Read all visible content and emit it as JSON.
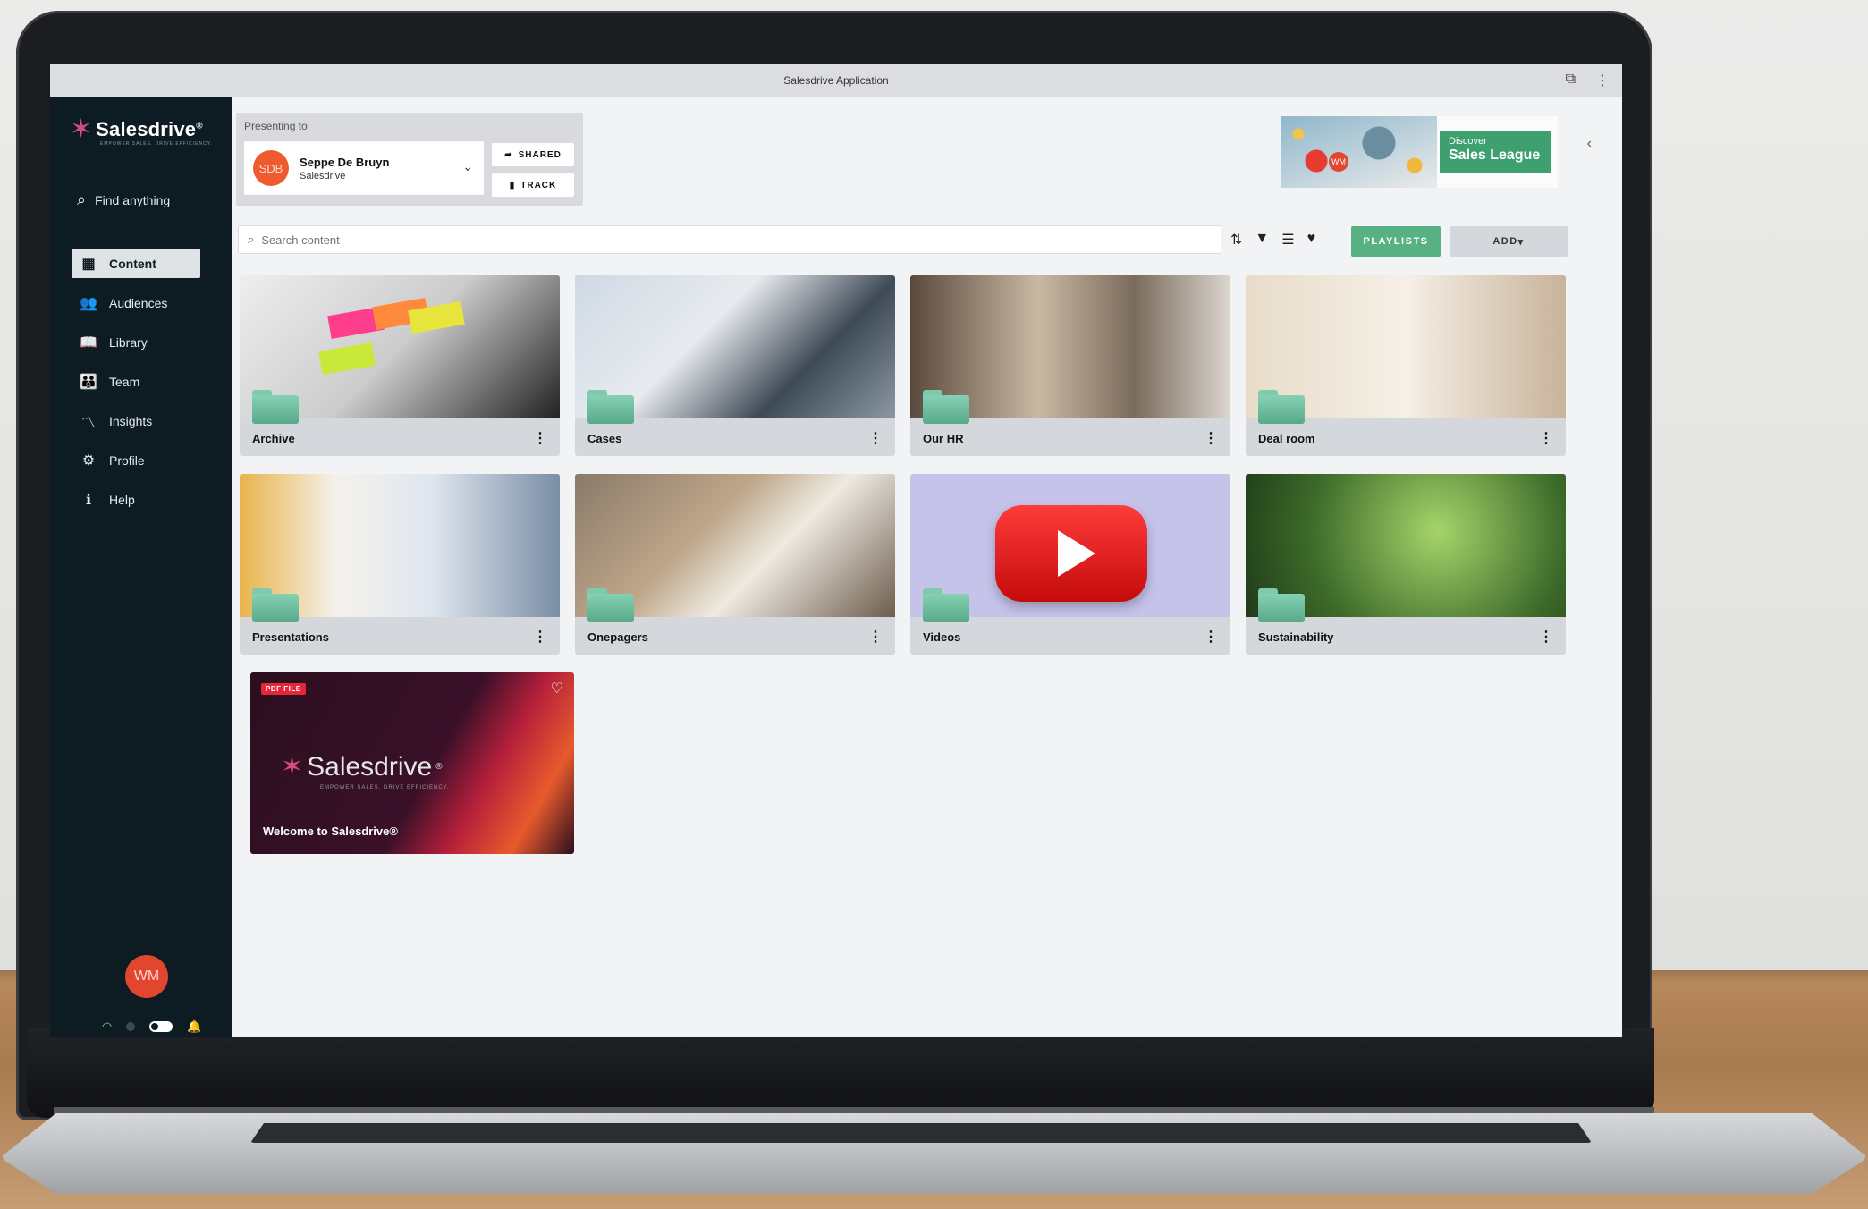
{
  "window": {
    "title": "Salesdrive Application"
  },
  "sidebar": {
    "logo_text": "Salesdrive",
    "logo_tagline": "EMPOWER SALES. DRIVE EFFICIENCY.",
    "find_label": "Find anything",
    "items": [
      {
        "label": "Content",
        "icon": "grid-icon",
        "active": true
      },
      {
        "label": "Audiences",
        "icon": "users-icon"
      },
      {
        "label": "Library",
        "icon": "book-icon"
      },
      {
        "label": "Team",
        "icon": "team-icon"
      },
      {
        "label": "Insights",
        "icon": "chart-line-icon"
      },
      {
        "label": "Profile",
        "icon": "gear-icon"
      },
      {
        "label": "Help",
        "icon": "info-icon"
      }
    ],
    "avatar_initials": "WM"
  },
  "presenting": {
    "label": "Presenting to:",
    "contact_initials": "SDB",
    "contact_name": "Seppe De Bruyn",
    "contact_company": "Salesdrive",
    "shared_label": "SHARED",
    "track_label": "TRACK"
  },
  "promo": {
    "line1": "Discover",
    "line2": "Sales League",
    "avatar_initials": "WM"
  },
  "search": {
    "placeholder": "Search content"
  },
  "actions": {
    "playlists_label": "PLAYLISTS",
    "add_label": "ADD"
  },
  "folders": [
    {
      "title": "Archive"
    },
    {
      "title": "Cases"
    },
    {
      "title": "Our HR"
    },
    {
      "title": "Deal room"
    },
    {
      "title": "Presentations"
    },
    {
      "title": "Onepagers"
    },
    {
      "title": "Videos"
    },
    {
      "title": "Sustainability"
    }
  ],
  "pdf_item": {
    "badge": "PDF FILE",
    "brand": "Salesdrive",
    "tagline": "EMPOWER SALES. DRIVE EFFICIENCY.",
    "title": "Welcome to Salesdrive®"
  },
  "colors": {
    "sidebar_bg": "#0d1b22",
    "accent_green": "#58b182",
    "avatar_red": "#e2462f"
  }
}
